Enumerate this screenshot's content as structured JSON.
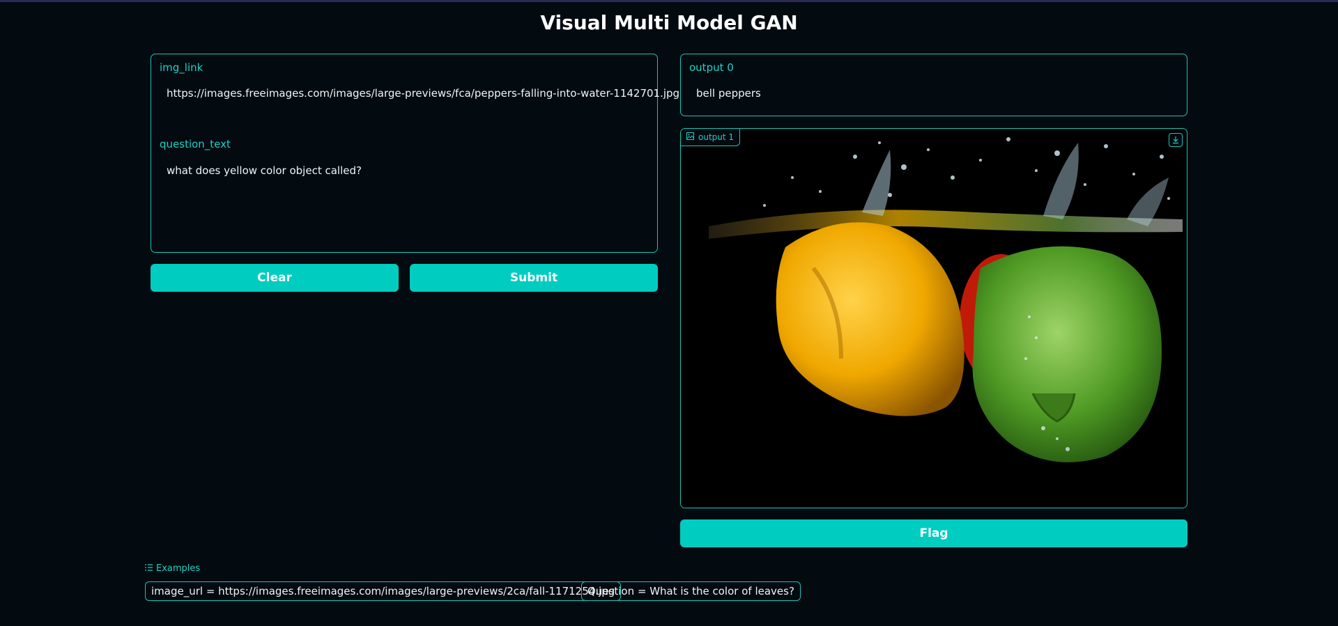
{
  "app": {
    "title": "Visual Multi Model GAN"
  },
  "inputs": {
    "img_link": {
      "label": "img_link",
      "value": "https://images.freeimages.com/images/large-previews/fca/peppers-falling-into-water-1142701.jpg"
    },
    "question_text": {
      "label": "question_text",
      "value": "what does yellow color object called?"
    }
  },
  "buttons": {
    "clear": "Clear",
    "submit": "Submit",
    "flag": "Flag"
  },
  "outputs": {
    "output0": {
      "label": "output 0",
      "value": "bell peppers"
    },
    "output1": {
      "label": "output 1",
      "image_description": ""
    }
  },
  "examples": {
    "header": "Examples",
    "items": [
      "image_url = https://images.freeimages.com/images/large-previews/2ca/fall-1171254.jpg",
      "Question = What is the color of leaves?"
    ]
  },
  "colors": {
    "accent": "#00cdc0",
    "border": "#14c8b8",
    "background": "#030a10"
  },
  "icons": {
    "image_tag": "image-icon",
    "download": "download-icon",
    "examples": "list-icon"
  }
}
